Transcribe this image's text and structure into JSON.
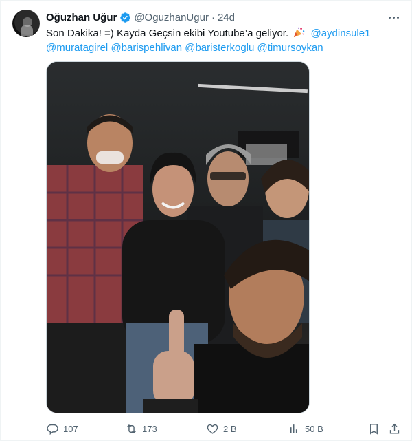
{
  "tweet": {
    "author_name": "Oğuzhan Uğur",
    "handle": "@OguzhanUgur",
    "separator": "·",
    "time": "24d",
    "text_main": "Son Dakika! =) Kayda Geçsin ekibi Youtube’a geliyor.",
    "mentions": [
      "@aydinsule1",
      "@muratagirel",
      "@barispehlivan",
      "@baristerkoglu",
      "@timursoykan"
    ]
  },
  "actions": {
    "replies": "107",
    "reposts": "173",
    "likes": "2 B",
    "views": "50 B"
  },
  "icons": {
    "verified": "verified-badge-icon",
    "more": "more-icon",
    "party": "party-popper-icon",
    "reply": "reply-icon",
    "repost": "repost-icon",
    "like": "heart-icon",
    "views": "views-icon",
    "bookmark": "bookmark-icon",
    "share": "share-icon"
  },
  "colors": {
    "accent": "#1d9bf0",
    "secondary_text": "#536471",
    "primary_text": "#0f1419"
  }
}
